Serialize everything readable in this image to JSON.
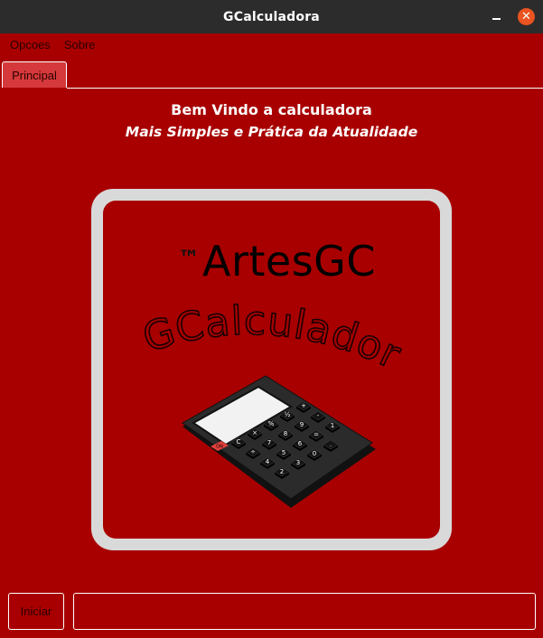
{
  "window": {
    "title": "GCalculadora",
    "close_glyph": "✕"
  },
  "menu": {
    "items": [
      {
        "label": "Opcoes"
      },
      {
        "label": "Sobre"
      }
    ]
  },
  "tabs": [
    {
      "label": "Principal",
      "active": true
    }
  ],
  "main": {
    "welcome": "Bem Vindo a calculadora",
    "subtitle": "Mais Simples e Prática da Atualidade"
  },
  "logo": {
    "trademark": "™",
    "brand": "ArtesGC",
    "app_name": "GCalculadora",
    "calc_keys": [
      "C",
      "×",
      "%",
      "½",
      "+",
      "÷",
      "7",
      "8",
      "9",
      "-",
      "4",
      "5",
      "6",
      "=",
      "1",
      "2",
      "3",
      "0",
      "."
    ],
    "on_key": "ON"
  },
  "footer": {
    "start_button": "Iniciar",
    "input_value": "",
    "input_placeholder": ""
  },
  "colors": {
    "background": "#a80000",
    "titlebar": "#2c2c2c",
    "close_button": "#e95420",
    "logo_frame": "#d9d9d9",
    "tab": "#d6393b",
    "on_key": "#e3403c"
  }
}
